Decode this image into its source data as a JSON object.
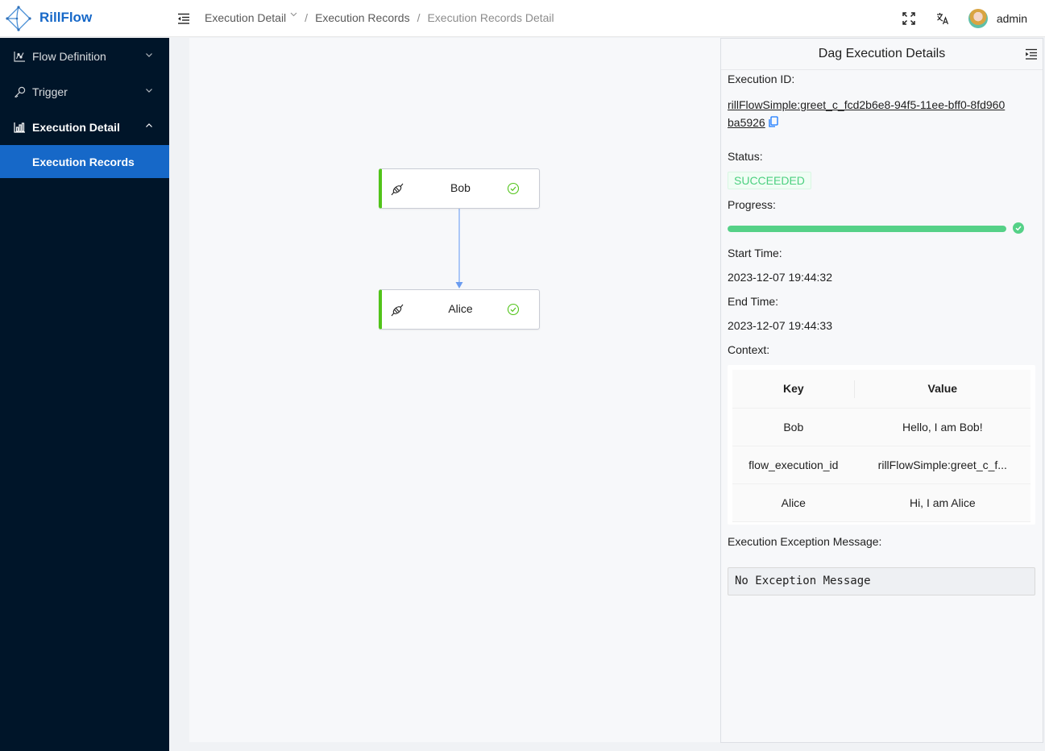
{
  "header": {
    "brand": "RillFlow",
    "breadcrumb": [
      "Execution Detail",
      "Execution Records",
      "Execution Records Detail"
    ],
    "user": "admin",
    "icons": [
      "menu-fold-icon",
      "fullscreen-icon",
      "translate-icon",
      "avatar"
    ]
  },
  "sidebar": {
    "items": [
      {
        "label": "Flow Definition",
        "icon": "chart-line-icon",
        "expanded": false
      },
      {
        "label": "Trigger",
        "icon": "key-icon",
        "expanded": false
      },
      {
        "label": "Execution Detail",
        "icon": "bar-chart-icon",
        "expanded": true,
        "children": [
          {
            "label": "Execution Records",
            "active": true
          }
        ]
      }
    ]
  },
  "dag": {
    "nodes": [
      {
        "label": "Bob",
        "status": "success"
      },
      {
        "label": "Alice",
        "status": "success"
      }
    ],
    "edges": [
      {
        "from": "Bob",
        "to": "Alice"
      }
    ]
  },
  "panel": {
    "title": "Dag Execution Details",
    "execution_id_label": "Execution ID:",
    "execution_id": "rillFlowSimple:greet_c_fcd2b6e8-94f5-11ee-bff0-8fd960ba5926",
    "status_label": "Status:",
    "status": "SUCCEEDED",
    "progress_label": "Progress:",
    "progress_percent": 100,
    "start_time_label": "Start Time:",
    "start_time": "2023-12-07 19:44:32",
    "end_time_label": "End Time:",
    "end_time": "2023-12-07 19:44:33",
    "context_label": "Context:",
    "context_table": {
      "columns": [
        "Key",
        "Value"
      ],
      "rows": [
        [
          "Bob",
          "Hello, I am Bob!"
        ],
        [
          "flow_execution_id",
          "rillFlowSimple:greet_c_f..."
        ],
        [
          "Alice",
          "Hi, I am Alice"
        ]
      ]
    },
    "exception_label": "Execution Exception Message:",
    "exception_message": "No Exception Message"
  },
  "colors": {
    "brand": "#1668c8",
    "sidebar_bg": "#001529",
    "success": "#52c41a",
    "progress": "#55d187",
    "edge": "#7aa7f5"
  }
}
